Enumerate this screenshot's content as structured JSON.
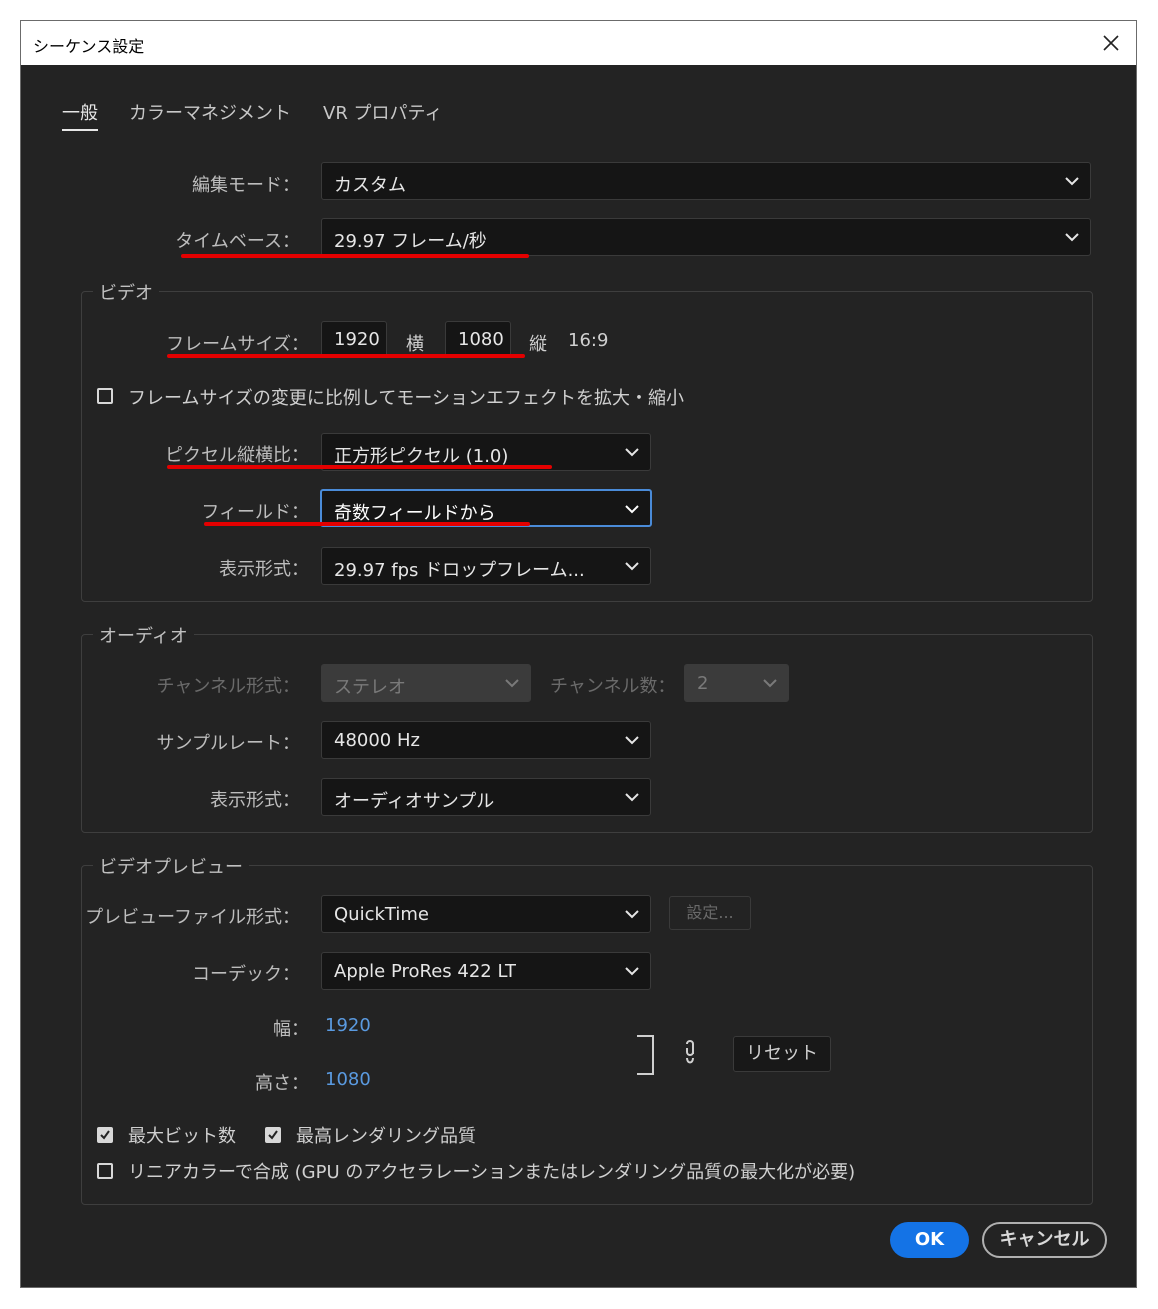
{
  "window": {
    "title": "シーケンス設定"
  },
  "tabs": [
    {
      "label": "一般",
      "active": true
    },
    {
      "label": "カラーマネジメント"
    },
    {
      "label": "VR プロパティ"
    }
  ],
  "general": {
    "edit_mode": {
      "label": "編集モード：",
      "value": "カスタム"
    },
    "timebase": {
      "label": "タイムベース：",
      "value": "29.97  フレーム/秒"
    }
  },
  "video": {
    "title": "ビデオ",
    "frame_size": {
      "label": "フレームサイズ：",
      "width": "1920",
      "width_unit": "横",
      "height": "1080",
      "height_unit": "縦",
      "ratio": "16:9"
    },
    "scale_checkbox": {
      "label": "フレームサイズの変更に比例してモーションエフェクトを拡大・縮小",
      "checked": false
    },
    "pixel_aspect": {
      "label": "ピクセル縦横比：",
      "value": "正方形ピクセル (1.0)"
    },
    "fields": {
      "label": "フィールド：",
      "value": "奇数フィールドから"
    },
    "display_format": {
      "label": "表示形式：",
      "value": "29.97 fps ドロップフレーム..."
    }
  },
  "audio": {
    "title": "オーディオ",
    "channel_format": {
      "label": "チャンネル形式：",
      "value": "ステレオ"
    },
    "channel_count": {
      "label": "チャンネル数：",
      "value": "2"
    },
    "sample_rate": {
      "label": "サンプルレート：",
      "value": "48000 Hz"
    },
    "display_format": {
      "label": "表示形式：",
      "value": "オーディオサンプル"
    }
  },
  "preview": {
    "title": "ビデオプレビュー",
    "file_format": {
      "label": "プレビューファイル形式：",
      "value": "QuickTime",
      "settings_button": "設定..."
    },
    "codec": {
      "label": "コーデック：",
      "value": "Apple ProRes 422 LT"
    },
    "width": {
      "label": "幅：",
      "value": "1920"
    },
    "height": {
      "label": "高さ：",
      "value": "1080"
    },
    "reset_button": "リセット",
    "max_bit_depth": {
      "label": "最大ビット数",
      "checked": true
    },
    "max_render_quality": {
      "label": "最高レンダリング品質",
      "checked": true
    },
    "linear_color": {
      "label": "リニアカラーで合成 (GPU のアクセラレーションまたはレンダリング品質の最大化が必要)",
      "checked": false
    }
  },
  "buttons": {
    "ok": "OK",
    "cancel": "キャンセル"
  },
  "colors": {
    "accent": "#1473e6",
    "annotation_red": "#e40000",
    "link_blue": "#5a9ae0",
    "background": "#232323"
  }
}
